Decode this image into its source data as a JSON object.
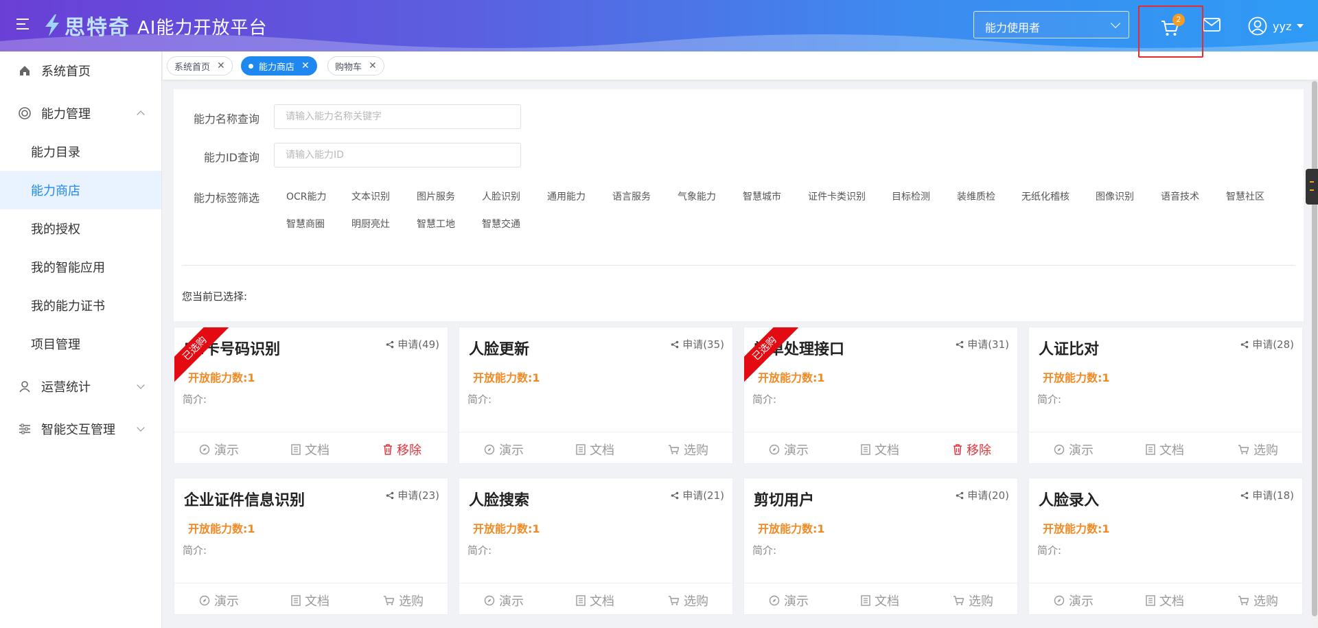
{
  "header": {
    "logo_text": "思特奇",
    "platform_title": "AI能力开放平台",
    "role_select_value": "能力使用者",
    "cart_count": "2",
    "username": "yyz",
    "colors": {
      "accent": "#1e87f0",
      "cart_highlight": "#e8292d",
      "badge": "#f59a23"
    }
  },
  "sidebar": {
    "home": "系统首页",
    "ability_mgmt": "能力管理",
    "sub_items": [
      "能力目录",
      "能力商店",
      "我的授权",
      "我的智能应用",
      "我的能力证书",
      "项目管理"
    ],
    "active_sub": "能力商店",
    "ops_stats": "运营统计",
    "interaction_mgmt": "智能交互管理"
  },
  "tabs": [
    {
      "label": "系统首页",
      "active": false
    },
    {
      "label": "能力商店",
      "active": true
    },
    {
      "label": "购物车",
      "active": false
    }
  ],
  "filter": {
    "name_label": "能力名称查询",
    "name_placeholder": "请输入能力名称关键字",
    "id_label": "能力ID查询",
    "id_placeholder": "请输入能力ID",
    "tags_label": "能力标签筛选",
    "tags": [
      "OCR能力",
      "文本识别",
      "图片服务",
      "人脸识别",
      "通用能力",
      "语言服务",
      "气象能力",
      "智慧城市",
      "证件卡类识别",
      "目标检测",
      "装维质检",
      "无纸化稽核",
      "图像识别",
      "语音技术",
      "智慧社区",
      "智慧商圈",
      "明厨亮灶",
      "智慧工地",
      "智慧交通"
    ],
    "selected_label": "您当前已选择:"
  },
  "cards": [
    {
      "title": "IM卡号码识别",
      "apply": "申请(49)",
      "open": "开放能力数:1",
      "intro": "简介:",
      "ribbon": "已选购",
      "actions": [
        "演示",
        "文档",
        "移除"
      ],
      "selected": true
    },
    {
      "title": "人脸更新",
      "apply": "申请(35)",
      "open": "开放能力数:1",
      "intro": "简介:",
      "ribbon": "",
      "actions": [
        "演示",
        "文档",
        "选购"
      ],
      "selected": false
    },
    {
      "title": "常单处理接口",
      "apply": "申请(31)",
      "open": "开放能力数:1",
      "intro": "简介:",
      "ribbon": "已选购",
      "actions": [
        "演示",
        "文档",
        "移除"
      ],
      "selected": true
    },
    {
      "title": "人证比对",
      "apply": "申请(28)",
      "open": "开放能力数:1",
      "intro": "简介:",
      "ribbon": "",
      "actions": [
        "演示",
        "文档",
        "选购"
      ],
      "selected": false
    },
    {
      "title": "企业证件信息识别",
      "apply": "申请(23)",
      "open": "开放能力数:1",
      "intro": "简介:",
      "ribbon": "",
      "actions": [
        "演示",
        "文档",
        "选购"
      ],
      "selected": false
    },
    {
      "title": "人脸搜索",
      "apply": "申请(21)",
      "open": "开放能力数:1",
      "intro": "简介:",
      "ribbon": "",
      "actions": [
        "演示",
        "文档",
        "选购"
      ],
      "selected": false
    },
    {
      "title": "剪切用户",
      "apply": "申请(20)",
      "open": "开放能力数:1",
      "intro": "简介:",
      "ribbon": "",
      "actions": [
        "演示",
        "文档",
        "选购"
      ],
      "selected": false
    },
    {
      "title": "人脸录入",
      "apply": "申请(18)",
      "open": "开放能力数:1",
      "intro": "简介:",
      "ribbon": "",
      "actions": [
        "演示",
        "文档",
        "选购"
      ],
      "selected": false
    }
  ]
}
